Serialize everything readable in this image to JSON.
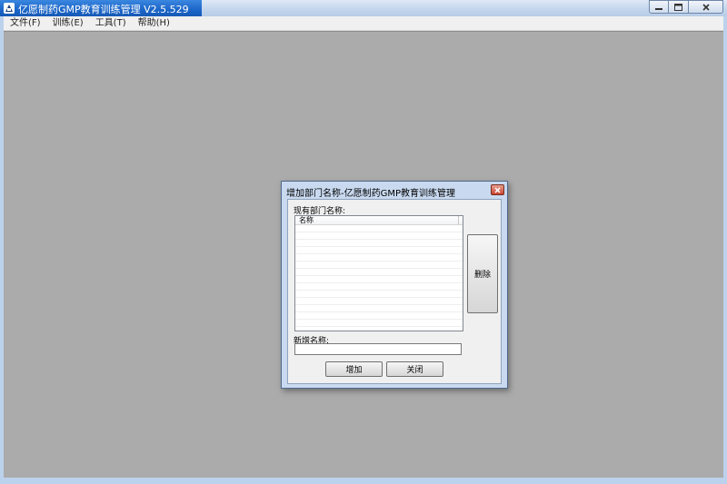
{
  "app": {
    "title": "亿愿制药GMP教育训练管理 V2.5.529"
  },
  "menu": {
    "items": [
      {
        "label": "文件(F)"
      },
      {
        "label": "训练(E)"
      },
      {
        "label": "工具(T)"
      },
      {
        "label": "帮助(H)"
      }
    ]
  },
  "dialog": {
    "title": "增加部门名称-亿愿制药GMP教育训练管理",
    "existing_label": "现有部门名称:",
    "list": {
      "columns": [
        "名称"
      ],
      "rows": []
    },
    "delete_button": "删除",
    "new_label": "新增名称:",
    "new_value": "",
    "add_button": "增加",
    "close_button": "关闭"
  },
  "colors": {
    "title_accent": "#1c66c8",
    "workspace": "#ababab",
    "dialog_client": "#f0f0f0"
  }
}
